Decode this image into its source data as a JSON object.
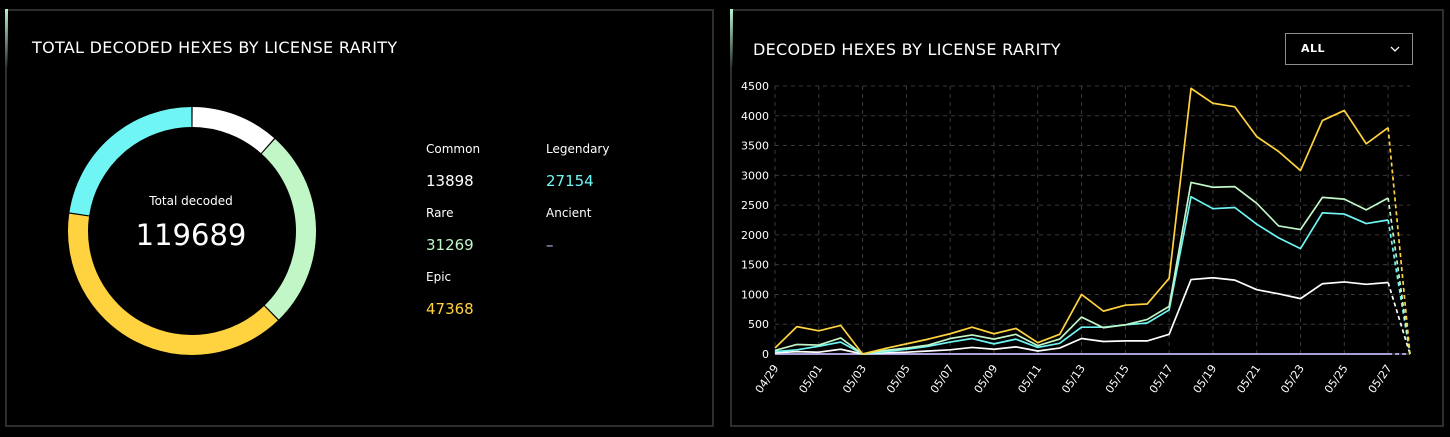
{
  "left_panel": {
    "title": "TOTAL DECODED HEXES BY LICENSE RARITY",
    "center_label": "Total decoded",
    "center_value": "119689",
    "legend": [
      {
        "name": "Common",
        "value": "13898",
        "color": "#ffffff"
      },
      {
        "name": "Legendary",
        "value": "27154",
        "color": "#6ff6f4"
      },
      {
        "name": "Rare",
        "value": "31269",
        "color": "#c1f6c7"
      },
      {
        "name": "Ancient",
        "value": "–",
        "color": "#c3b5f7"
      },
      {
        "name": "Epic",
        "value": "47368",
        "color": "#ffd23f"
      }
    ]
  },
  "right_panel": {
    "title": "DECODED HEXES BY LICENSE RARITY",
    "dropdown": {
      "value": "ALL"
    }
  },
  "chart_data": [
    {
      "type": "pie",
      "title": "TOTAL DECODED HEXES BY LICENSE RARITY",
      "categories": [
        "Common",
        "Rare",
        "Epic",
        "Legendary",
        "Ancient"
      ],
      "values": [
        13898,
        31269,
        47368,
        27154,
        0
      ],
      "colors": [
        "#ffffff",
        "#c1f6c7",
        "#ffd23f",
        "#6ff6f4",
        "#c3b5f7"
      ]
    },
    {
      "type": "line",
      "title": "DECODED HEXES BY LICENSE RARITY",
      "x": [
        "04/29",
        "04/30",
        "05/01",
        "05/02",
        "05/03",
        "05/04",
        "05/05",
        "05/06",
        "05/07",
        "05/08",
        "05/09",
        "05/10",
        "05/11",
        "05/12",
        "05/13",
        "05/14",
        "05/15",
        "05/16",
        "05/17",
        "05/18",
        "05/19",
        "05/20",
        "05/21",
        "05/22",
        "05/23",
        "05/24",
        "05/25",
        "05/26",
        "05/27",
        "05/28"
      ],
      "x_tick_labels": [
        "04/29",
        "05/01",
        "05/03",
        "05/05",
        "05/07",
        "05/09",
        "05/11",
        "05/13",
        "05/15",
        "05/17",
        "05/19",
        "05/21",
        "05/23",
        "05/25",
        "05/27"
      ],
      "ylim": [
        0,
        4500
      ],
      "y_ticks": [
        0,
        500,
        1000,
        1500,
        2000,
        2500,
        3000,
        3500,
        4000,
        4500
      ],
      "grid": true,
      "series": [
        {
          "color": "#ffd23f",
          "values": [
            100,
            460,
            390,
            480,
            0,
            90,
            170,
            250,
            340,
            450,
            340,
            430,
            190,
            330,
            1000,
            720,
            820,
            840,
            1270,
            4460,
            4210,
            4150,
            3650,
            3400,
            3080,
            3920,
            4090,
            3530,
            3800,
            0
          ]
        },
        {
          "color": "#c1f6c7",
          "values": [
            60,
            160,
            150,
            270,
            0,
            60,
            100,
            150,
            260,
            320,
            250,
            330,
            140,
            250,
            620,
            440,
            490,
            580,
            800,
            2880,
            2800,
            2810,
            2530,
            2150,
            2090,
            2630,
            2600,
            2420,
            2620,
            0
          ]
        },
        {
          "color": "#6ff6f4",
          "values": [
            40,
            70,
            130,
            200,
            0,
            40,
            80,
            130,
            200,
            260,
            170,
            250,
            110,
            180,
            450,
            450,
            490,
            520,
            740,
            2640,
            2440,
            2460,
            2180,
            1950,
            1770,
            2370,
            2350,
            2190,
            2250,
            0
          ]
        },
        {
          "color": "#ffffff",
          "values": [
            20,
            40,
            30,
            80,
            0,
            20,
            30,
            50,
            70,
            110,
            80,
            120,
            50,
            100,
            260,
            210,
            220,
            220,
            330,
            1250,
            1280,
            1240,
            1080,
            1010,
            930,
            1180,
            1210,
            1170,
            1200,
            0
          ]
        },
        {
          "color": "#c3b5f7",
          "values": [
            0,
            0,
            0,
            0,
            0,
            0,
            0,
            0,
            0,
            0,
            0,
            0,
            0,
            0,
            0,
            0,
            0,
            0,
            0,
            0,
            0,
            0,
            0,
            0,
            0,
            0,
            0,
            0,
            0,
            0
          ]
        }
      ]
    }
  ]
}
